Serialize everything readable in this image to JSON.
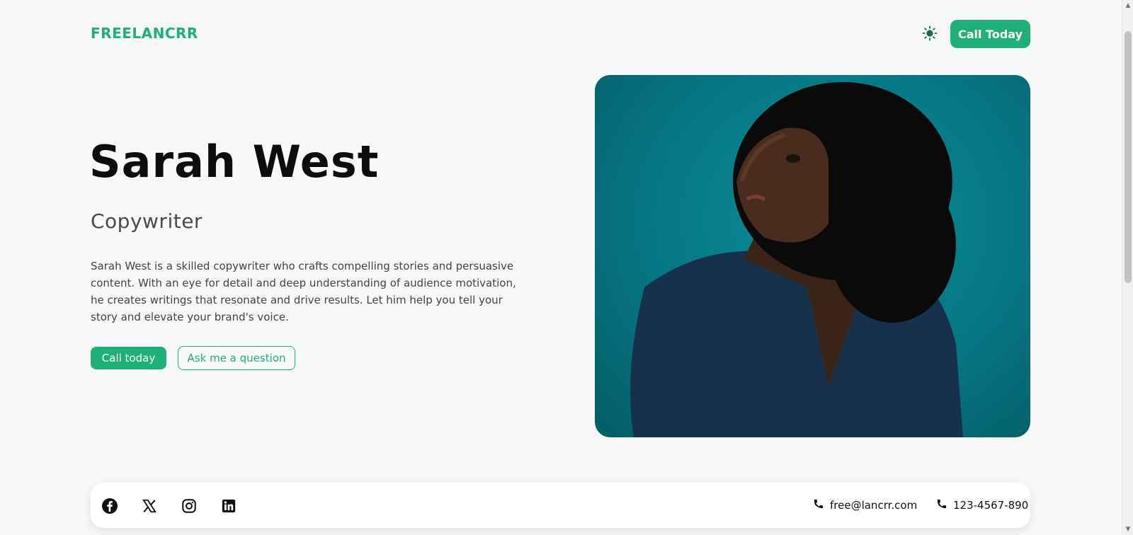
{
  "header": {
    "logo": "FREELANCRR",
    "theme_toggle_icon": "sun-icon",
    "cta_label": "Call Today"
  },
  "hero": {
    "name": "Sarah West",
    "role": "Copywriter",
    "bio": "Sarah West is a skilled copywriter who crafts compelling stories and persuasive content. With an eye for detail and deep understanding of audience motivation, he creates writings that resonate and drive results. Let him help you tell your story and elevate your brand's voice.",
    "primary_button": "Call today",
    "secondary_button": "Ask me a question"
  },
  "portrait": {
    "icon": "portrait-photo"
  },
  "footer": {
    "socials": [
      "facebook-icon",
      "x-icon",
      "instagram-icon",
      "linkedin-icon"
    ],
    "email": "free@lancrr.com",
    "phone": "123-4567-890"
  },
  "colors": {
    "accent": "#1fb07a",
    "background": "#f7f8fa",
    "photo_background": "#067683"
  }
}
